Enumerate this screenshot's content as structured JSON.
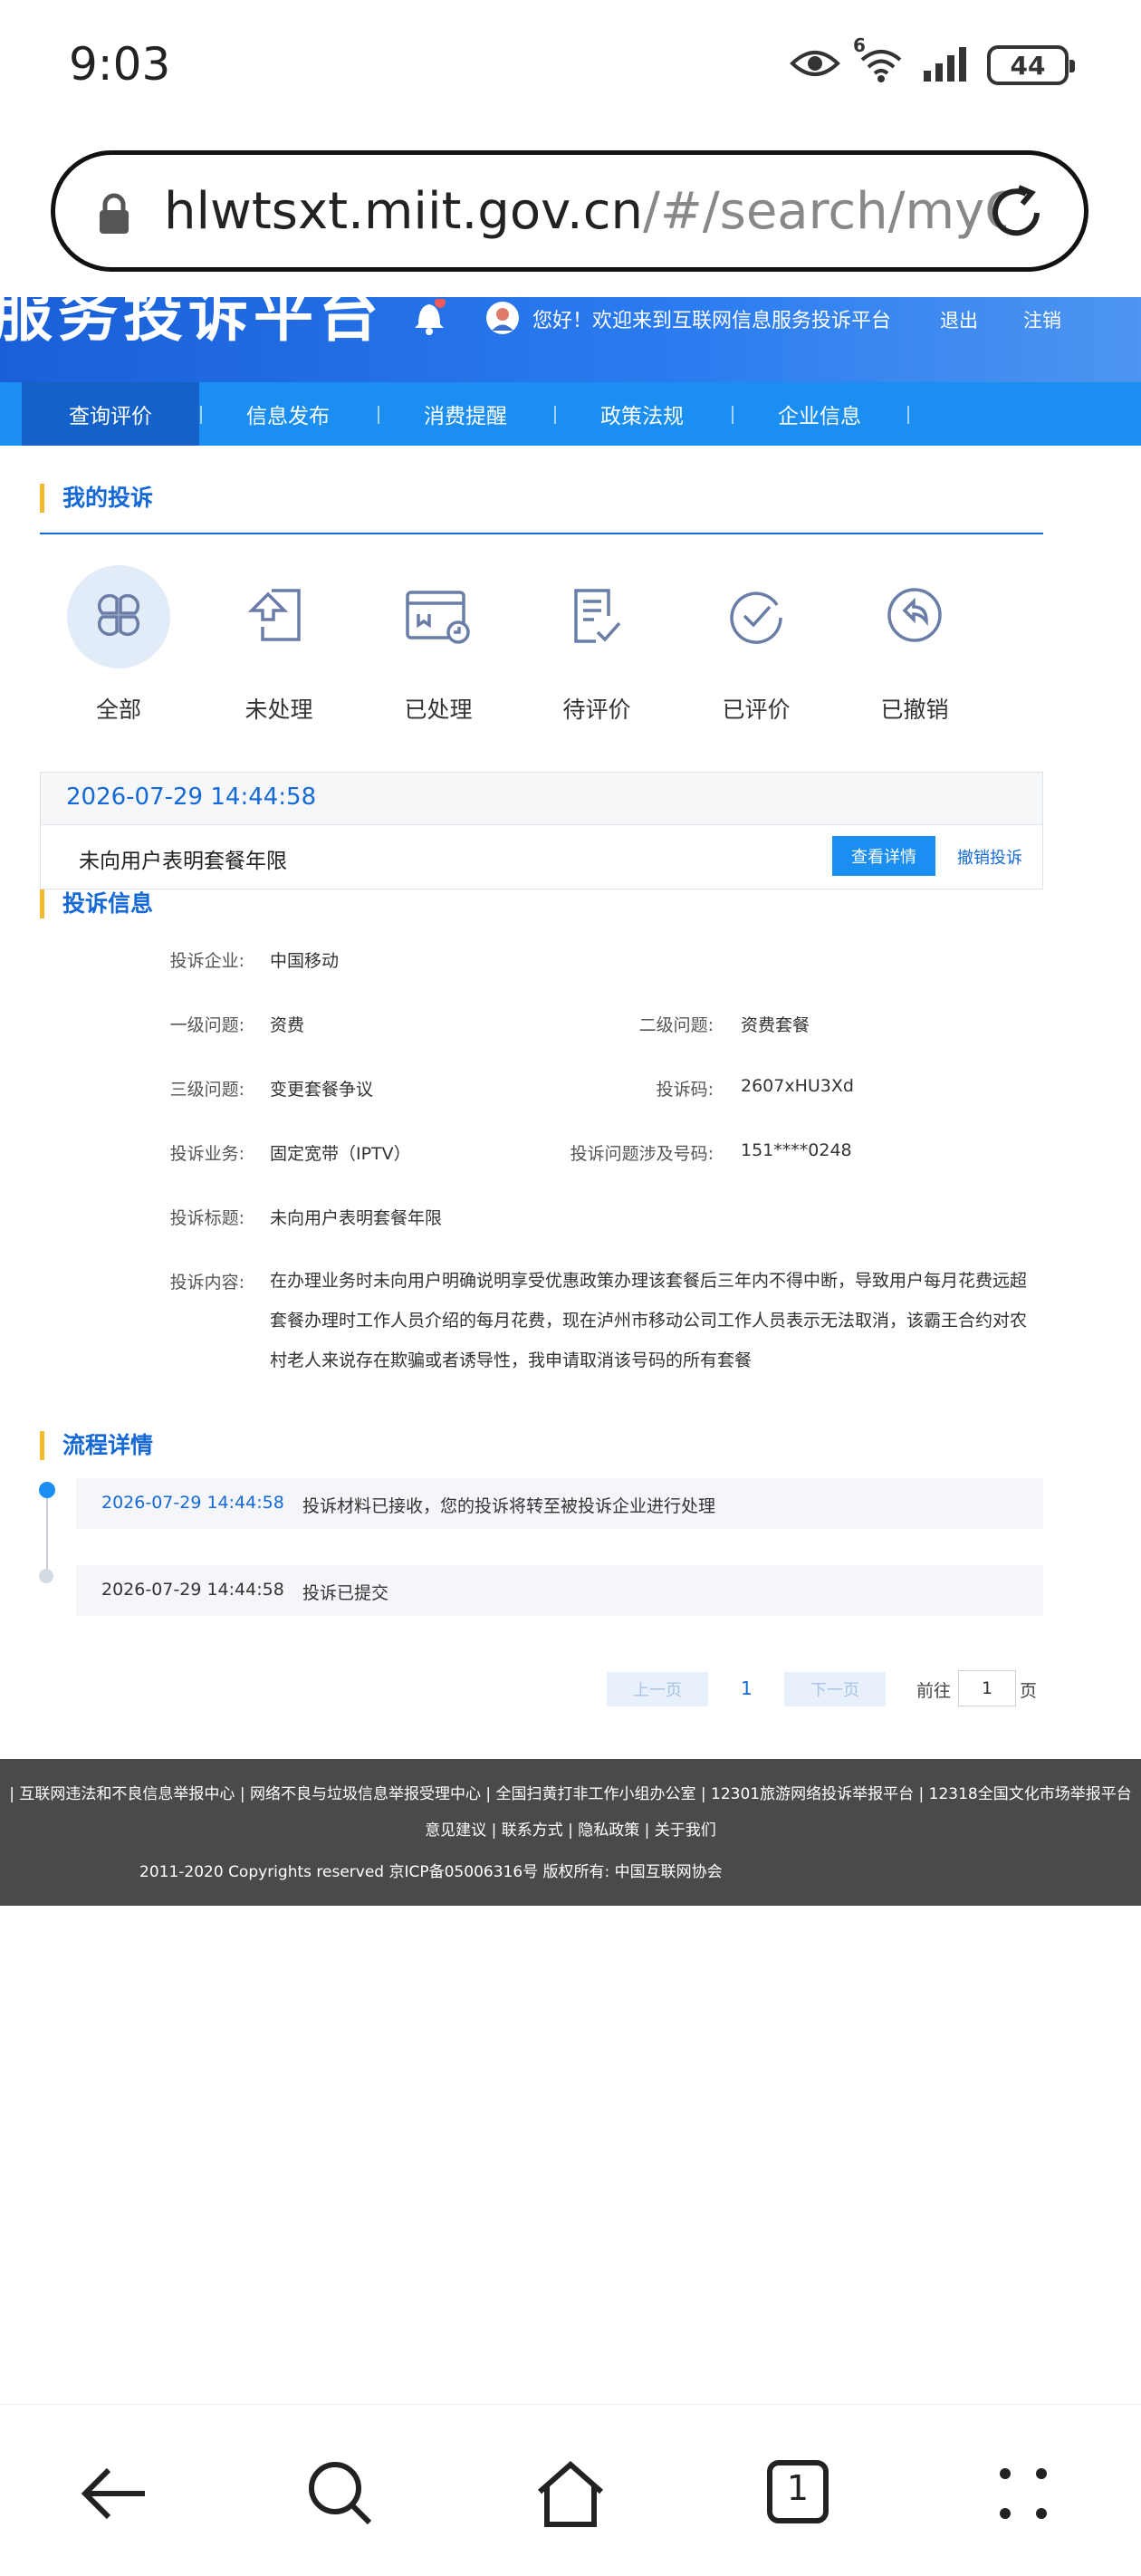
{
  "status_bar": {
    "time": "9:03",
    "network": "6",
    "battery": "44"
  },
  "browser": {
    "url_host": "hlwtsxt.miit.gov.cn",
    "url_path": "/#/search/myCon",
    "tab_count": "1"
  },
  "header": {
    "title": "服务投诉平台",
    "welcome": "您好！欢迎来到互联网信息服务投诉平台",
    "logout": "退出",
    "cancel_account": "注销"
  },
  "nav": {
    "items": [
      "查询评价",
      "信息发布",
      "消费提醒",
      "政策法规",
      "企业信息"
    ],
    "active": "查询评价"
  },
  "my_complaints": {
    "heading": "我的投诉",
    "categories": [
      {
        "label": "全部",
        "icon": "grid-icon"
      },
      {
        "label": "未处理",
        "icon": "upload-doc-icon"
      },
      {
        "label": "已处理",
        "icon": "processed-card-icon"
      },
      {
        "label": "待评价",
        "icon": "clipboard-check-icon"
      },
      {
        "label": "已评价",
        "icon": "check-circle-icon"
      },
      {
        "label": "已撤销",
        "icon": "undo-circle-icon"
      }
    ]
  },
  "complaint": {
    "date": "2026-07-29 14:44:58",
    "title": "未向用户表明套餐年限",
    "detail_button": "查看详情",
    "revoke_button": "撤销投诉"
  },
  "complaint_info": {
    "heading": "投诉信息",
    "company_label": "投诉企业:",
    "company": "中国移动",
    "level1_label": "一级问题:",
    "level1": "资费",
    "level2_label": "二级问题:",
    "level2": "资费套餐",
    "level3_label": "三级问题:",
    "level3": "变更套餐争议",
    "code_label": "投诉码:",
    "code": "2607xHU3Xd",
    "business_label": "投诉业务:",
    "business": "固定宽带（IPTV）",
    "number_label": "投诉问题涉及号码:",
    "number": "151****0248",
    "subject_label": "投诉标题:",
    "subject": "未向用户表明套餐年限",
    "content_label": "投诉内容:",
    "content": "在办理业务时未向用户明确说明享受优惠政策办理该套餐后三年内不得中断，导致用户每月花费远超套餐办理时工作人员介绍的每月花费，现在泸州市移动公司工作人员表示无法取消，该霸王合约对农村老人来说存在欺骗或者诱导性，我申请取消该号码的所有套餐"
  },
  "flow": {
    "heading": "流程详情",
    "steps": [
      {
        "date": "2026-07-29 14:44:58",
        "text": "投诉材料已接收，您的投诉将转至被投诉企业进行处理",
        "color": "#1569d6"
      },
      {
        "date": "2026-07-29 14:44:58",
        "text": "投诉已提交",
        "color": "#333333"
      }
    ]
  },
  "pagination": {
    "prev": "上一页",
    "current": "1",
    "next": "下一页",
    "goto": "前往",
    "input_value": "1",
    "page_unit": "页"
  },
  "footer": {
    "links": "| 互联网违法和不良信息举报中心 | 网络不良与垃圾信息举报受理中心 | 全国扫黄打非工作小组办公室 | 12301旅游网络投诉举报平台 | 12318全国文化市场举报平台",
    "links2": "意见建议 | 联系方式 | 隐私政策 | 关于我们",
    "copyright": "2011-2020 Copyrights reserved 京ICP备05006316号 版权所有: 中国互联网协会"
  }
}
